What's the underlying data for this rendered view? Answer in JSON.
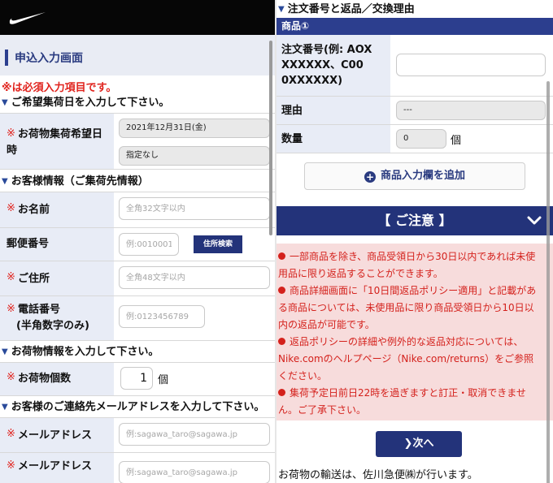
{
  "left": {
    "screen_title": "申込入力画面",
    "required_note": "※は必須入力項目です。",
    "pickup_section": "ご希望集荷日を入力して下さい。",
    "pickup_label_line1": "お荷物集荷希望日",
    "pickup_label_line2": "時",
    "pickup_date_value": "2021年12月31日(金)",
    "pickup_time_value": "指定なし",
    "customer_section": "お客様情報（ご集荷先情報）",
    "name_label": "お名前",
    "name_placeholder": "全角32文字以内",
    "postal_label": "郵便番号",
    "postal_placeholder": "例:0010001",
    "address_search_label": "住所検索",
    "address_label": "ご住所",
    "address_placeholder": "全角48文字以内",
    "phone_label_line1": "電話番号",
    "phone_label_line2": "(半角数字のみ)",
    "phone_placeholder": "例:0123456789",
    "package_section": "お荷物情報を入力して下さい。",
    "package_count_label": "お荷物個数",
    "package_count_value": "1",
    "package_unit": "個",
    "email_section": "お客様のご連絡先メールアドレスを入力して下さい。",
    "email_label": "メールアドレス",
    "email_placeholder": "例:sagawa_taro@sagawa.jp",
    "email_confirm_label": "メールアドレス",
    "email_confirm_placeholder": "例:sagawa_taro@sagawa.jp",
    "asterisk": "※"
  },
  "right": {
    "section_title": "注文番号と返品／交換理由",
    "product_header": "商品①",
    "order_label_line1": "注文番号(例: AOX",
    "order_label_line2": "XXXXXX、C00",
    "order_label_line3": "0XXXXXX)",
    "order_value": "",
    "reason_label": "理由",
    "reason_value": "---",
    "quantity_label": "数量",
    "quantity_value": "0",
    "quantity_unit": "個",
    "add_product_label": "商品入力欄を追加",
    "notice_title": "【 ご注意 】",
    "notices": [
      [
        "一部商品を除き、商品受領日から30日以内であれば未使",
        "用品に限り返品することができます。"
      ],
      [
        "商品詳細画面に「10日間返品ポリシー適用」と記載があ",
        "る商品については、未使用品に限り商品受領日から10日以",
        "内の返品が可能です。"
      ],
      [
        "返品ポリシーの詳細や例外的な返品対応については、",
        "Nike.comのヘルプページ（Nike.com/returns）をご参照",
        "ください。"
      ],
      [
        "集荷予定日前日22時を過ぎますと訂正・取消できませ",
        "ん。ご了承下さい。"
      ]
    ],
    "next_label": "次へ",
    "footer_text": "お荷物の輸送は、佐川急便㈱が行います。"
  },
  "colors": {
    "navy": "#23337a",
    "label_bg": "#e8ecf6",
    "required_red": "#e0221c",
    "notice_bg": "#f7dcdc"
  }
}
